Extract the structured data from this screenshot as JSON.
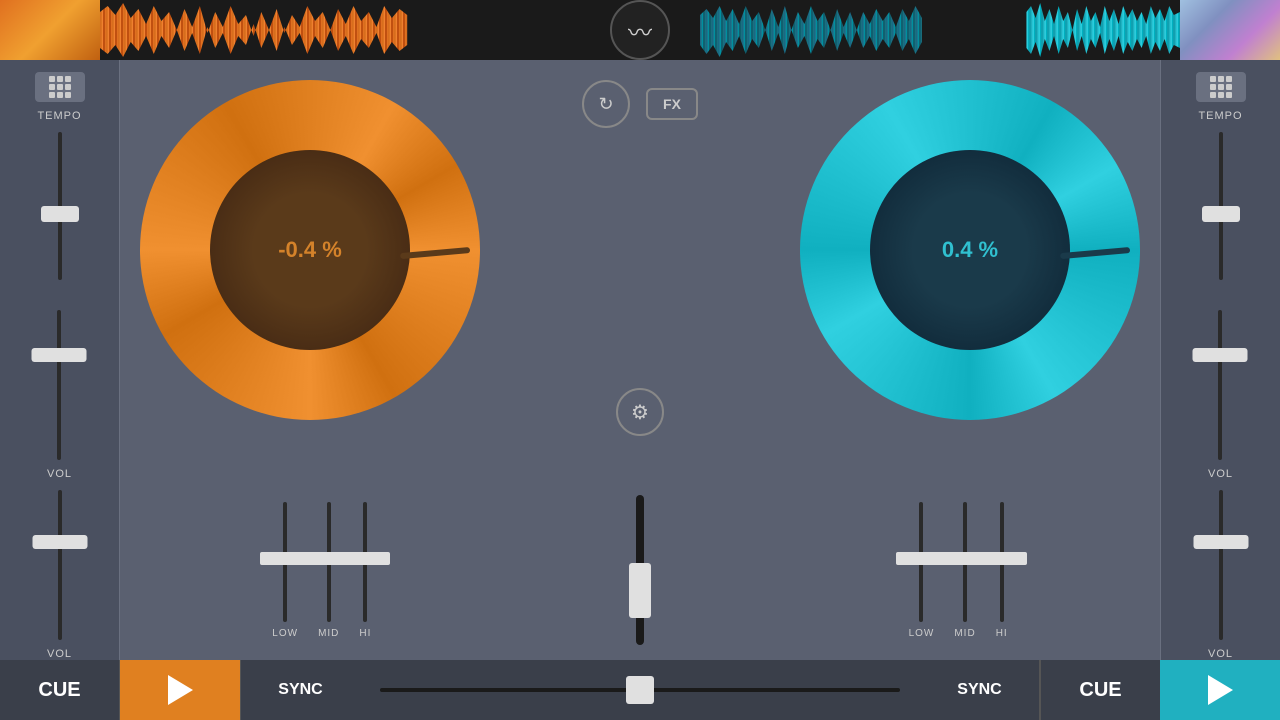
{
  "topBar": {
    "leftAlbumAlt": "Left album art",
    "rightAlbumAlt": "Right album art",
    "logoLabel": "DJ App Logo"
  },
  "leftDeck": {
    "tempoLabel": "TEMPO",
    "volLabel": "VOL",
    "tempoValue": "-0.4",
    "percentSign": "%",
    "fullPercent": "-0.4 %",
    "gridBtnLabel": "Grid",
    "eqLow": "LOW",
    "eqMid": "MID",
    "eqHi": "HI"
  },
  "rightDeck": {
    "tempoLabel": "TEMPO",
    "volLabel": "VOL",
    "tempoValue": "0.4",
    "percentSign": "%",
    "fullPercent": "0.4 %",
    "gridBtnLabel": "Grid",
    "eqLow": "LOW",
    "eqMid": "MID",
    "eqHi": "HI"
  },
  "centerControls": {
    "reloadLabel": "↻",
    "fxLabel": "FX",
    "settingsLabel": "⚙"
  },
  "bottomBar": {
    "cueLeft": "CUE",
    "playLeft": "▶",
    "syncLeft": "SYNC",
    "syncRight": "SYNC",
    "cueRight": "CUE",
    "playRight": "▶"
  }
}
